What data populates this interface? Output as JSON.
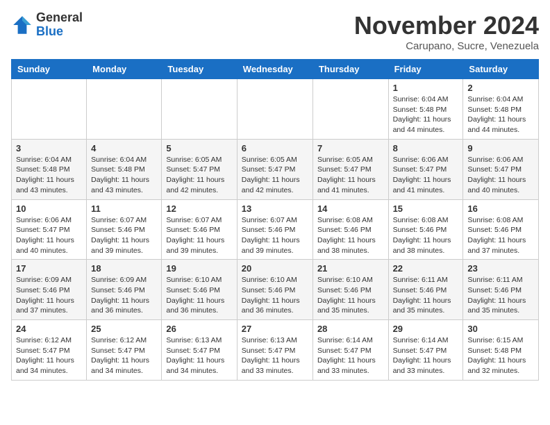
{
  "header": {
    "logo_line1": "General",
    "logo_line2": "Blue",
    "month": "November 2024",
    "location": "Carupano, Sucre, Venezuela"
  },
  "weekdays": [
    "Sunday",
    "Monday",
    "Tuesday",
    "Wednesday",
    "Thursday",
    "Friday",
    "Saturday"
  ],
  "weeks": [
    [
      {
        "day": "",
        "info": ""
      },
      {
        "day": "",
        "info": ""
      },
      {
        "day": "",
        "info": ""
      },
      {
        "day": "",
        "info": ""
      },
      {
        "day": "",
        "info": ""
      },
      {
        "day": "1",
        "info": "Sunrise: 6:04 AM\nSunset: 5:48 PM\nDaylight: 11 hours\nand 44 minutes."
      },
      {
        "day": "2",
        "info": "Sunrise: 6:04 AM\nSunset: 5:48 PM\nDaylight: 11 hours\nand 44 minutes."
      }
    ],
    [
      {
        "day": "3",
        "info": "Sunrise: 6:04 AM\nSunset: 5:48 PM\nDaylight: 11 hours\nand 43 minutes."
      },
      {
        "day": "4",
        "info": "Sunrise: 6:04 AM\nSunset: 5:48 PM\nDaylight: 11 hours\nand 43 minutes."
      },
      {
        "day": "5",
        "info": "Sunrise: 6:05 AM\nSunset: 5:47 PM\nDaylight: 11 hours\nand 42 minutes."
      },
      {
        "day": "6",
        "info": "Sunrise: 6:05 AM\nSunset: 5:47 PM\nDaylight: 11 hours\nand 42 minutes."
      },
      {
        "day": "7",
        "info": "Sunrise: 6:05 AM\nSunset: 5:47 PM\nDaylight: 11 hours\nand 41 minutes."
      },
      {
        "day": "8",
        "info": "Sunrise: 6:06 AM\nSunset: 5:47 PM\nDaylight: 11 hours\nand 41 minutes."
      },
      {
        "day": "9",
        "info": "Sunrise: 6:06 AM\nSunset: 5:47 PM\nDaylight: 11 hours\nand 40 minutes."
      }
    ],
    [
      {
        "day": "10",
        "info": "Sunrise: 6:06 AM\nSunset: 5:47 PM\nDaylight: 11 hours\nand 40 minutes."
      },
      {
        "day": "11",
        "info": "Sunrise: 6:07 AM\nSunset: 5:46 PM\nDaylight: 11 hours\nand 39 minutes."
      },
      {
        "day": "12",
        "info": "Sunrise: 6:07 AM\nSunset: 5:46 PM\nDaylight: 11 hours\nand 39 minutes."
      },
      {
        "day": "13",
        "info": "Sunrise: 6:07 AM\nSunset: 5:46 PM\nDaylight: 11 hours\nand 39 minutes."
      },
      {
        "day": "14",
        "info": "Sunrise: 6:08 AM\nSunset: 5:46 PM\nDaylight: 11 hours\nand 38 minutes."
      },
      {
        "day": "15",
        "info": "Sunrise: 6:08 AM\nSunset: 5:46 PM\nDaylight: 11 hours\nand 38 minutes."
      },
      {
        "day": "16",
        "info": "Sunrise: 6:08 AM\nSunset: 5:46 PM\nDaylight: 11 hours\nand 37 minutes."
      }
    ],
    [
      {
        "day": "17",
        "info": "Sunrise: 6:09 AM\nSunset: 5:46 PM\nDaylight: 11 hours\nand 37 minutes."
      },
      {
        "day": "18",
        "info": "Sunrise: 6:09 AM\nSunset: 5:46 PM\nDaylight: 11 hours\nand 36 minutes."
      },
      {
        "day": "19",
        "info": "Sunrise: 6:10 AM\nSunset: 5:46 PM\nDaylight: 11 hours\nand 36 minutes."
      },
      {
        "day": "20",
        "info": "Sunrise: 6:10 AM\nSunset: 5:46 PM\nDaylight: 11 hours\nand 36 minutes."
      },
      {
        "day": "21",
        "info": "Sunrise: 6:10 AM\nSunset: 5:46 PM\nDaylight: 11 hours\nand 35 minutes."
      },
      {
        "day": "22",
        "info": "Sunrise: 6:11 AM\nSunset: 5:46 PM\nDaylight: 11 hours\nand 35 minutes."
      },
      {
        "day": "23",
        "info": "Sunrise: 6:11 AM\nSunset: 5:46 PM\nDaylight: 11 hours\nand 35 minutes."
      }
    ],
    [
      {
        "day": "24",
        "info": "Sunrise: 6:12 AM\nSunset: 5:47 PM\nDaylight: 11 hours\nand 34 minutes."
      },
      {
        "day": "25",
        "info": "Sunrise: 6:12 AM\nSunset: 5:47 PM\nDaylight: 11 hours\nand 34 minutes."
      },
      {
        "day": "26",
        "info": "Sunrise: 6:13 AM\nSunset: 5:47 PM\nDaylight: 11 hours\nand 34 minutes."
      },
      {
        "day": "27",
        "info": "Sunrise: 6:13 AM\nSunset: 5:47 PM\nDaylight: 11 hours\nand 33 minutes."
      },
      {
        "day": "28",
        "info": "Sunrise: 6:14 AM\nSunset: 5:47 PM\nDaylight: 11 hours\nand 33 minutes."
      },
      {
        "day": "29",
        "info": "Sunrise: 6:14 AM\nSunset: 5:47 PM\nDaylight: 11 hours\nand 33 minutes."
      },
      {
        "day": "30",
        "info": "Sunrise: 6:15 AM\nSunset: 5:48 PM\nDaylight: 11 hours\nand 32 minutes."
      }
    ]
  ]
}
